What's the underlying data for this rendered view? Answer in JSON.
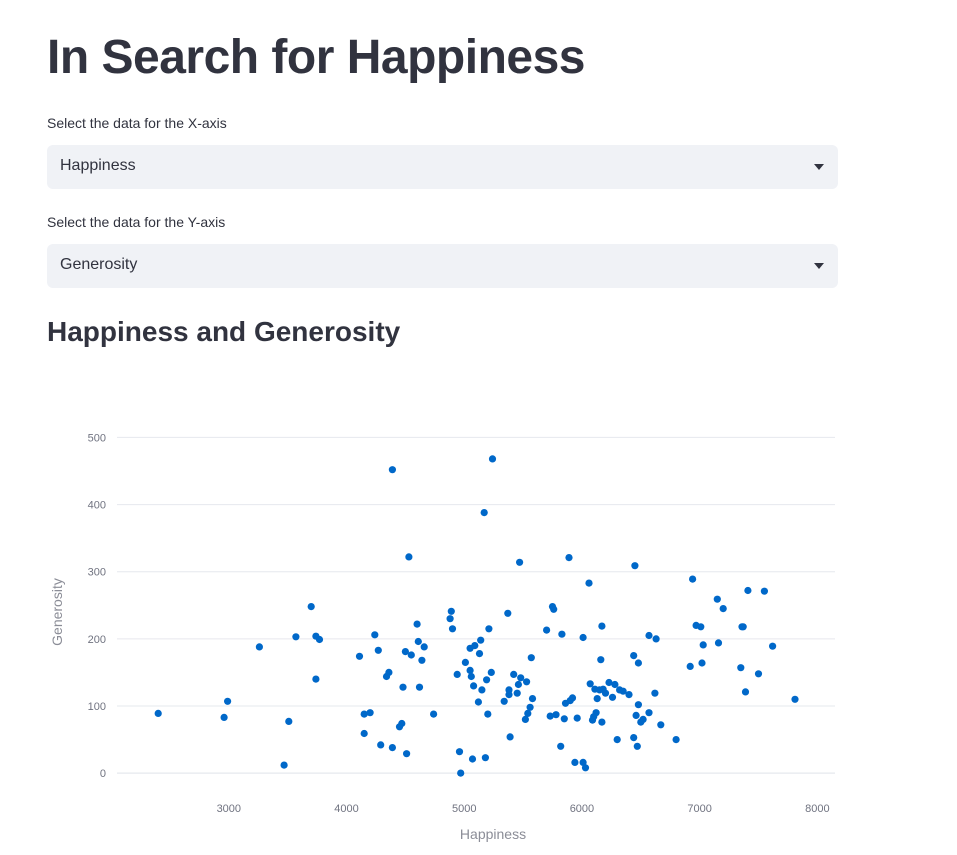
{
  "page": {
    "title": "In Search for Happiness"
  },
  "x_select": {
    "label": "Select the data for the X-axis",
    "value": "Happiness"
  },
  "y_select": {
    "label": "Select the data for the Y-axis",
    "value": "Generosity"
  },
  "chart_heading": "Happiness and Generosity",
  "colors": {
    "point": "#0068c9",
    "grid": "#e6e8ee",
    "select_bg": "#f0f2f6",
    "text": "#31333f"
  },
  "icons": {
    "select_chevron": "chevron-down-icon"
  },
  "chart_data": {
    "type": "scatter",
    "title": "",
    "xlabel": "Happiness",
    "ylabel": "Generosity",
    "xlim": [
      2050,
      8150
    ],
    "ylim": [
      -40,
      520
    ],
    "x_ticks": [
      3000,
      4000,
      5000,
      6000,
      7000,
      8000
    ],
    "y_ticks": [
      0,
      100,
      200,
      300,
      400,
      500
    ],
    "grid": "horizontal",
    "points": [
      [
        2400,
        89
      ],
      [
        2960,
        83
      ],
      [
        2990,
        107
      ],
      [
        3260,
        188
      ],
      [
        3470,
        12
      ],
      [
        3510,
        77
      ],
      [
        3570,
        203
      ],
      [
        3700,
        248
      ],
      [
        3740,
        140
      ],
      [
        3740,
        204
      ],
      [
        3770,
        199
      ],
      [
        4110,
        174
      ],
      [
        4150,
        59
      ],
      [
        4150,
        88
      ],
      [
        4200,
        90
      ],
      [
        4240,
        206
      ],
      [
        4270,
        183
      ],
      [
        4290,
        42
      ],
      [
        4340,
        144
      ],
      [
        4360,
        150
      ],
      [
        4390,
        452
      ],
      [
        4390,
        38
      ],
      [
        4450,
        69
      ],
      [
        4470,
        74
      ],
      [
        4480,
        128
      ],
      [
        4500,
        181
      ],
      [
        4510,
        29
      ],
      [
        4530,
        322
      ],
      [
        4550,
        176
      ],
      [
        4600,
        222
      ],
      [
        4610,
        196
      ],
      [
        4620,
        128
      ],
      [
        4640,
        168
      ],
      [
        4660,
        188
      ],
      [
        4740,
        88
      ],
      [
        4880,
        230
      ],
      [
        4890,
        241
      ],
      [
        4900,
        215
      ],
      [
        4940,
        147
      ],
      [
        4960,
        32
      ],
      [
        4970,
        0
      ],
      [
        5010,
        165
      ],
      [
        5050,
        186
      ],
      [
        5050,
        153
      ],
      [
        5060,
        144
      ],
      [
        5070,
        21
      ],
      [
        5080,
        130
      ],
      [
        5090,
        190
      ],
      [
        5120,
        106
      ],
      [
        5130,
        178
      ],
      [
        5140,
        198
      ],
      [
        5150,
        124
      ],
      [
        5170,
        388
      ],
      [
        5180,
        23
      ],
      [
        5190,
        139
      ],
      [
        5200,
        88
      ],
      [
        5210,
        215
      ],
      [
        5230,
        150
      ],
      [
        5240,
        468
      ],
      [
        5340,
        107
      ],
      [
        5370,
        238
      ],
      [
        5380,
        117
      ],
      [
        5380,
        124
      ],
      [
        5390,
        54
      ],
      [
        5420,
        147
      ],
      [
        5450,
        119
      ],
      [
        5460,
        132
      ],
      [
        5470,
        314
      ],
      [
        5480,
        142
      ],
      [
        5520,
        80
      ],
      [
        5530,
        136
      ],
      [
        5540,
        89
      ],
      [
        5560,
        98
      ],
      [
        5570,
        172
      ],
      [
        5580,
        111
      ],
      [
        5700,
        213
      ],
      [
        5730,
        85
      ],
      [
        5750,
        248
      ],
      [
        5760,
        244
      ],
      [
        5780,
        87
      ],
      [
        5820,
        40
      ],
      [
        5830,
        207
      ],
      [
        5850,
        81
      ],
      [
        5860,
        104
      ],
      [
        5890,
        321
      ],
      [
        5900,
        108
      ],
      [
        5920,
        112
      ],
      [
        5940,
        16
      ],
      [
        5960,
        82
      ],
      [
        6010,
        202
      ],
      [
        6010,
        16
      ],
      [
        6030,
        8
      ],
      [
        6060,
        283
      ],
      [
        6070,
        133
      ],
      [
        6090,
        79
      ],
      [
        6100,
        84
      ],
      [
        6110,
        125
      ],
      [
        6120,
        90
      ],
      [
        6130,
        111
      ],
      [
        6150,
        124
      ],
      [
        6160,
        169
      ],
      [
        6170,
        76
      ],
      [
        6170,
        219
      ],
      [
        6180,
        125
      ],
      [
        6200,
        119
      ],
      [
        6230,
        135
      ],
      [
        6260,
        113
      ],
      [
        6280,
        132
      ],
      [
        6300,
        50
      ],
      [
        6320,
        124
      ],
      [
        6350,
        122
      ],
      [
        6400,
        117
      ],
      [
        6440,
        175
      ],
      [
        6440,
        53
      ],
      [
        6450,
        309
      ],
      [
        6460,
        86
      ],
      [
        6470,
        40
      ],
      [
        6480,
        164
      ],
      [
        6480,
        102
      ],
      [
        6500,
        76
      ],
      [
        6520,
        80
      ],
      [
        6570,
        90
      ],
      [
        6570,
        205
      ],
      [
        6620,
        119
      ],
      [
        6630,
        200
      ],
      [
        6670,
        72
      ],
      [
        6800,
        50
      ],
      [
        6920,
        159
      ],
      [
        6940,
        289
      ],
      [
        6970,
        220
      ],
      [
        7010,
        218
      ],
      [
        7020,
        164
      ],
      [
        7030,
        191
      ],
      [
        7150,
        259
      ],
      [
        7160,
        194
      ],
      [
        7200,
        245
      ],
      [
        7350,
        157
      ],
      [
        7360,
        218
      ],
      [
        7370,
        218
      ],
      [
        7390,
        121
      ],
      [
        7410,
        272
      ],
      [
        7500,
        148
      ],
      [
        7550,
        271
      ],
      [
        7620,
        189
      ],
      [
        7810,
        110
      ]
    ]
  }
}
